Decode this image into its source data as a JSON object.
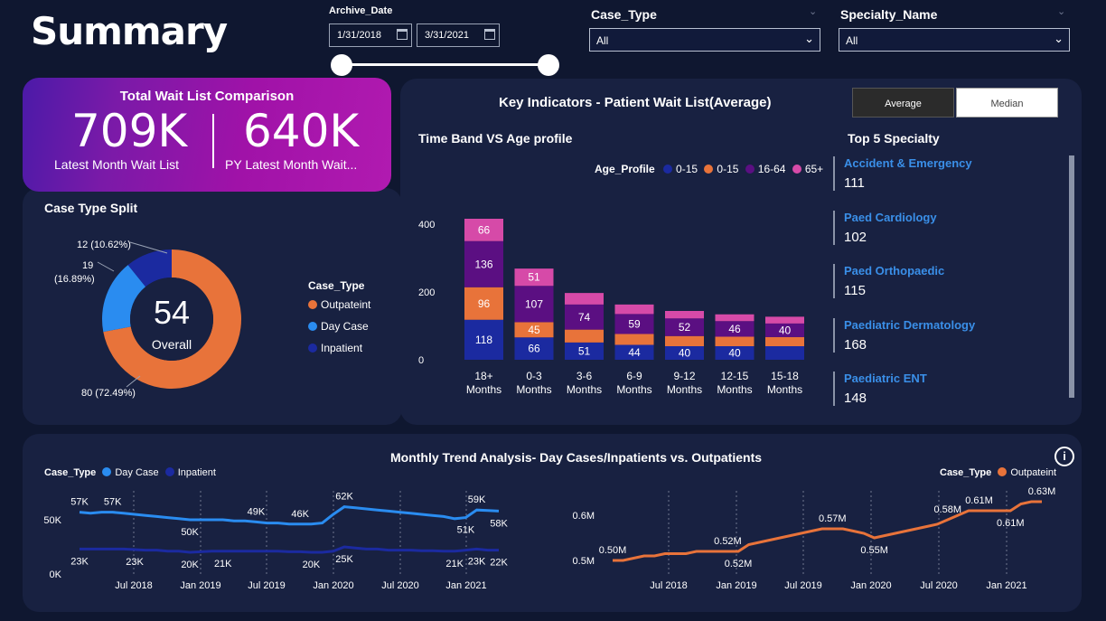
{
  "page": {
    "title": "Summary"
  },
  "date_filter": {
    "label": "Archive_Date",
    "start": "1/31/2018",
    "end": "3/31/2021"
  },
  "case_type_filter": {
    "label": "Case_Type",
    "value": "All"
  },
  "specialty_filter": {
    "label": "Specialty_Name",
    "value": "All"
  },
  "kpi": {
    "title": "Total Wait List Comparison",
    "latest_value": "709K",
    "latest_label": "Latest Month Wait List",
    "py_value": "640K",
    "py_label": "PY Latest Month Wait..."
  },
  "key_indicators": {
    "title": "Key Indicators - Patient Wait List(Average)",
    "toggle_average": "Average",
    "toggle_median": "Median"
  },
  "donut": {
    "title": "Case Type Split",
    "center_value": "54",
    "center_label": "Overall",
    "labels": {
      "inpatient": "12 (10.62%)",
      "day_case_count": "19",
      "day_case_pct": "(16.89%)",
      "outpatient": "80 (72.49%)"
    },
    "legend_title": "Case_Type",
    "legend": [
      "Outpateint",
      "Day Case",
      "Inpatient"
    ],
    "colors": {
      "outpatient": "#e8733a",
      "day_case": "#2a8cf0",
      "inpatient": "#1b2aa0"
    }
  },
  "stacked_bar": {
    "title": "Time Band VS Age profile",
    "legend_title": "Age_Profile",
    "legend": [
      "0-15",
      "0-15",
      "16-64",
      "65+"
    ]
  },
  "top5": {
    "title": "Top 5 Specialty",
    "items": [
      {
        "name": "Accident & Emergency",
        "value": "111"
      },
      {
        "name": "Paed Cardiology",
        "value": "102"
      },
      {
        "name": "Paed Orthopaedic",
        "value": "115"
      },
      {
        "name": "Paediatric Dermatology",
        "value": "168"
      },
      {
        "name": "Paediatric ENT",
        "value": "148"
      }
    ]
  },
  "trend": {
    "title": "Monthly Trend Analysis- Day Cases/Inpatients vs. Outpatients",
    "left_legend_title": "Case_Type",
    "left_legend": [
      "Day Case",
      "Inpatient"
    ],
    "right_legend_title": "Case_Type",
    "right_legend": [
      "Outpateint"
    ]
  },
  "chart_data": [
    {
      "type": "pie",
      "title": "Case Type Split",
      "categories": [
        "Outpateint",
        "Day Case",
        "Inpatient"
      ],
      "values": [
        80,
        19,
        12
      ],
      "percentages": [
        72.49,
        16.89,
        10.62
      ],
      "center": "54 Overall"
    },
    {
      "type": "bar",
      "title": "Time Band VS Age profile",
      "stacked": true,
      "categories": [
        "18+ Months",
        "0-3 Months",
        "3-6 Months",
        "6-9 Months",
        "9-12 Months",
        "12-15 Months",
        "15-18 Months"
      ],
      "ylim": [
        0,
        420
      ],
      "yticks": [
        0,
        200,
        400
      ],
      "series": [
        {
          "name": "0-15",
          "color": "#1b2aa0",
          "values": [
            118,
            66,
            51,
            44,
            40,
            40,
            40
          ],
          "labels": [
            "118",
            "66",
            "51",
            "44",
            "40",
            "40",
            ""
          ]
        },
        {
          "name": "0-15",
          "color": "#e8733a",
          "values": [
            96,
            45,
            38,
            32,
            30,
            28,
            27
          ],
          "labels": [
            "96",
            "45",
            "",
            "",
            "",
            "",
            ""
          ]
        },
        {
          "name": "16-64",
          "color": "#5b0f82",
          "values": [
            136,
            107,
            74,
            59,
            52,
            46,
            40
          ],
          "labels": [
            "136",
            "107",
            "74",
            "59",
            "52",
            "46",
            "40"
          ]
        },
        {
          "name": "65+",
          "color": "#d64aa8",
          "values": [
            66,
            51,
            34,
            28,
            22,
            20,
            20
          ],
          "labels": [
            "66",
            "51",
            "",
            "",
            "",
            "",
            ""
          ]
        }
      ]
    },
    {
      "type": "line",
      "title": "Monthly Trend Analysis (Day Case / Inpatient)",
      "x_ticks": [
        "Jul 2018",
        "Jan 2019",
        "Jul 2019",
        "Jan 2020",
        "Jul 2020",
        "Jan 2021"
      ],
      "yticks": [
        "0K",
        "50K"
      ],
      "ylim": [
        0,
        75
      ],
      "series": [
        {
          "name": "Day Case",
          "color": "#2a8cf0",
          "values": [
            57,
            56,
            57,
            57,
            56,
            55,
            54,
            53,
            52,
            51,
            50,
            50,
            50,
            50,
            49,
            49,
            48,
            47,
            47,
            46,
            46,
            46,
            47,
            55,
            62,
            61,
            60,
            59,
            58,
            57,
            56,
            55,
            54,
            53,
            51,
            52,
            59,
            58.5,
            58
          ],
          "labels": [
            {
              "i": 0,
              "text": "57K"
            },
            {
              "i": 3,
              "text": "57K"
            },
            {
              "i": 16,
              "text": "49K"
            },
            {
              "i": 10,
              "text": "50K"
            },
            {
              "i": 20,
              "text": "46K"
            },
            {
              "i": 24,
              "text": "62K"
            },
            {
              "i": 35,
              "text": "51K"
            },
            {
              "i": 36,
              "text": "59K"
            },
            {
              "i": 38,
              "text": "58K"
            }
          ]
        },
        {
          "name": "Inpatient",
          "color": "#1b2aa0",
          "values": [
            23,
            23,
            23,
            23,
            23,
            22.5,
            22,
            22,
            21,
            21,
            20,
            20.5,
            21,
            21,
            21,
            21,
            21,
            21,
            21,
            20.5,
            20.5,
            20,
            20,
            21,
            25,
            24,
            23,
            23,
            22,
            22,
            22,
            21.5,
            21.5,
            21,
            21,
            22,
            23,
            22,
            22
          ],
          "labels": [
            {
              "i": 0,
              "text": "23K"
            },
            {
              "i": 5,
              "text": "23K"
            },
            {
              "i": 10,
              "text": "20K"
            },
            {
              "i": 13,
              "text": "21K"
            },
            {
              "i": 21,
              "text": "20K"
            },
            {
              "i": 24,
              "text": "25K"
            },
            {
              "i": 34,
              "text": "21K"
            },
            {
              "i": 36,
              "text": "23K"
            },
            {
              "i": 38,
              "text": "22K"
            }
          ]
        }
      ]
    },
    {
      "type": "line",
      "title": "Monthly Trend Analysis (Outpatient)",
      "x_ticks": [
        "Jul 2018",
        "Jan 2019",
        "Jul 2019",
        "Jan 2020",
        "Jul 2020",
        "Jan 2021"
      ],
      "yticks": [
        "0.5M",
        "0.6M"
      ],
      "ylim": [
        0.47,
        0.65
      ],
      "series": [
        {
          "name": "Outpateint",
          "color": "#e8733a",
          "values": [
            0.5,
            0.5,
            0.505,
            0.51,
            0.51,
            0.515,
            0.515,
            0.515,
            0.52,
            0.52,
            0.52,
            0.52,
            0.52,
            0.535,
            0.54,
            0.545,
            0.55,
            0.555,
            0.56,
            0.565,
            0.57,
            0.57,
            0.57,
            0.565,
            0.56,
            0.55,
            0.555,
            0.56,
            0.565,
            0.57,
            0.575,
            0.58,
            0.59,
            0.6,
            0.61,
            0.61,
            0.61,
            0.61,
            0.61,
            0.625,
            0.63,
            0.63
          ],
          "labels": [
            {
              "i": 0,
              "text": "0.50M"
            },
            {
              "i": 11,
              "text": "0.52M"
            },
            {
              "i": 12,
              "text": "0.52M"
            },
            {
              "i": 21,
              "text": "0.57M"
            },
            {
              "i": 25,
              "text": "0.55M"
            },
            {
              "i": 32,
              "text": "0.58M"
            },
            {
              "i": 35,
              "text": "0.61M"
            },
            {
              "i": 38,
              "text": "0.61M"
            },
            {
              "i": 41,
              "text": "0.63M"
            }
          ]
        }
      ]
    }
  ]
}
